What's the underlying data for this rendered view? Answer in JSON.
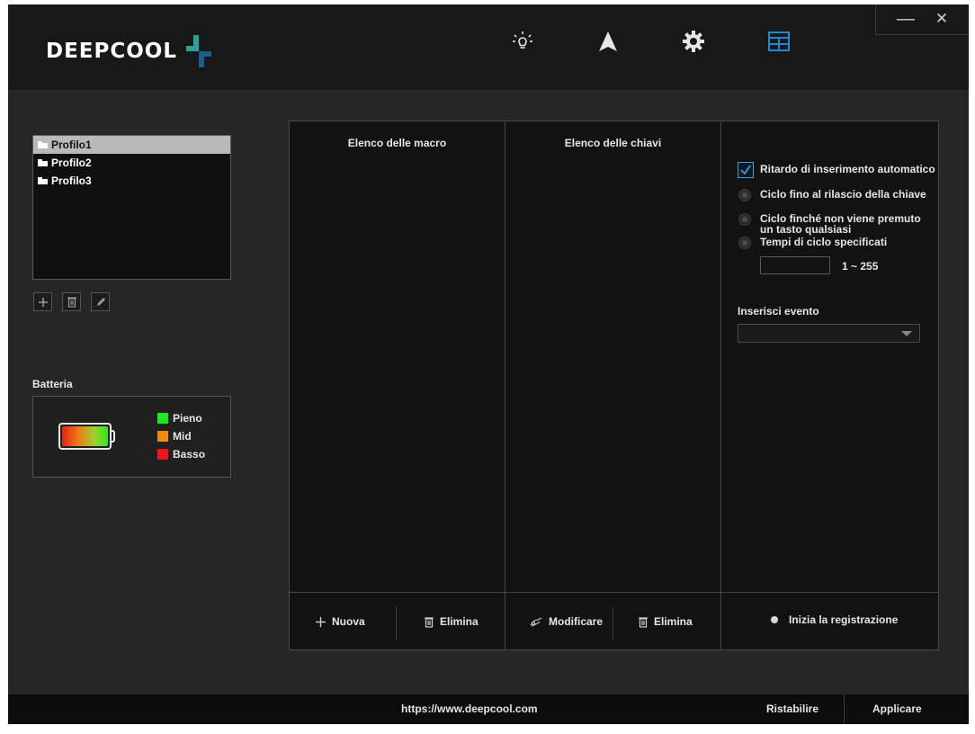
{
  "app": {
    "brand": "DEEPCOOL",
    "accent_color": "#1e88d0",
    "logo_accent_color": "#2aa39a"
  },
  "nav": [
    {
      "icon": "lighting-icon",
      "active": false
    },
    {
      "icon": "cursor-arrow-icon",
      "active": false
    },
    {
      "icon": "gear-icon",
      "active": false
    },
    {
      "icon": "macro-table-icon",
      "active": true
    }
  ],
  "window_controls": {
    "minimize": "—",
    "close": "✕"
  },
  "profiles": {
    "items": [
      {
        "label": "Profilo1",
        "selected": true
      },
      {
        "label": "Profilo2",
        "selected": false
      },
      {
        "label": "Profilo3",
        "selected": false
      }
    ],
    "actions": {
      "add_icon": "plus-icon",
      "delete_icon": "trash-icon",
      "edit_icon": "pencil-icon"
    }
  },
  "battery": {
    "title": "Batteria",
    "legend": [
      {
        "label": "Pieno",
        "color": "#1ee81e"
      },
      {
        "label": "Mid",
        "color": "#f28a12"
      },
      {
        "label": "Basso",
        "color": "#f0141c"
      }
    ]
  },
  "macro_panel": {
    "macro_list_header": "Elenco delle macro",
    "key_list_header": "Elenco delle chiavi",
    "options": {
      "auto_delay_label": "Ritardo di inserimento automatico",
      "auto_delay_checked": true,
      "loop_release_label": "Ciclo fino al rilascio della chiave",
      "loop_any_key_label_line1": "Ciclo finché non viene premuto",
      "loop_any_key_label_line2": "un tasto qualsiasi",
      "loop_count_label": "Tempi di ciclo specificati",
      "loop_count_value": "",
      "loop_count_range": "1 ~ 255"
    },
    "insert_event_label": "Inserisci evento",
    "insert_event_value": "",
    "buttons": {
      "new": "Nuova",
      "delete_macro": "Elimina",
      "modify": "Modificare",
      "delete_key": "Elimina",
      "record": "Inizia la registrazione"
    }
  },
  "footer": {
    "url": "https://www.deepcool.com",
    "reset": "Ristabilire",
    "apply": "Applicare"
  }
}
